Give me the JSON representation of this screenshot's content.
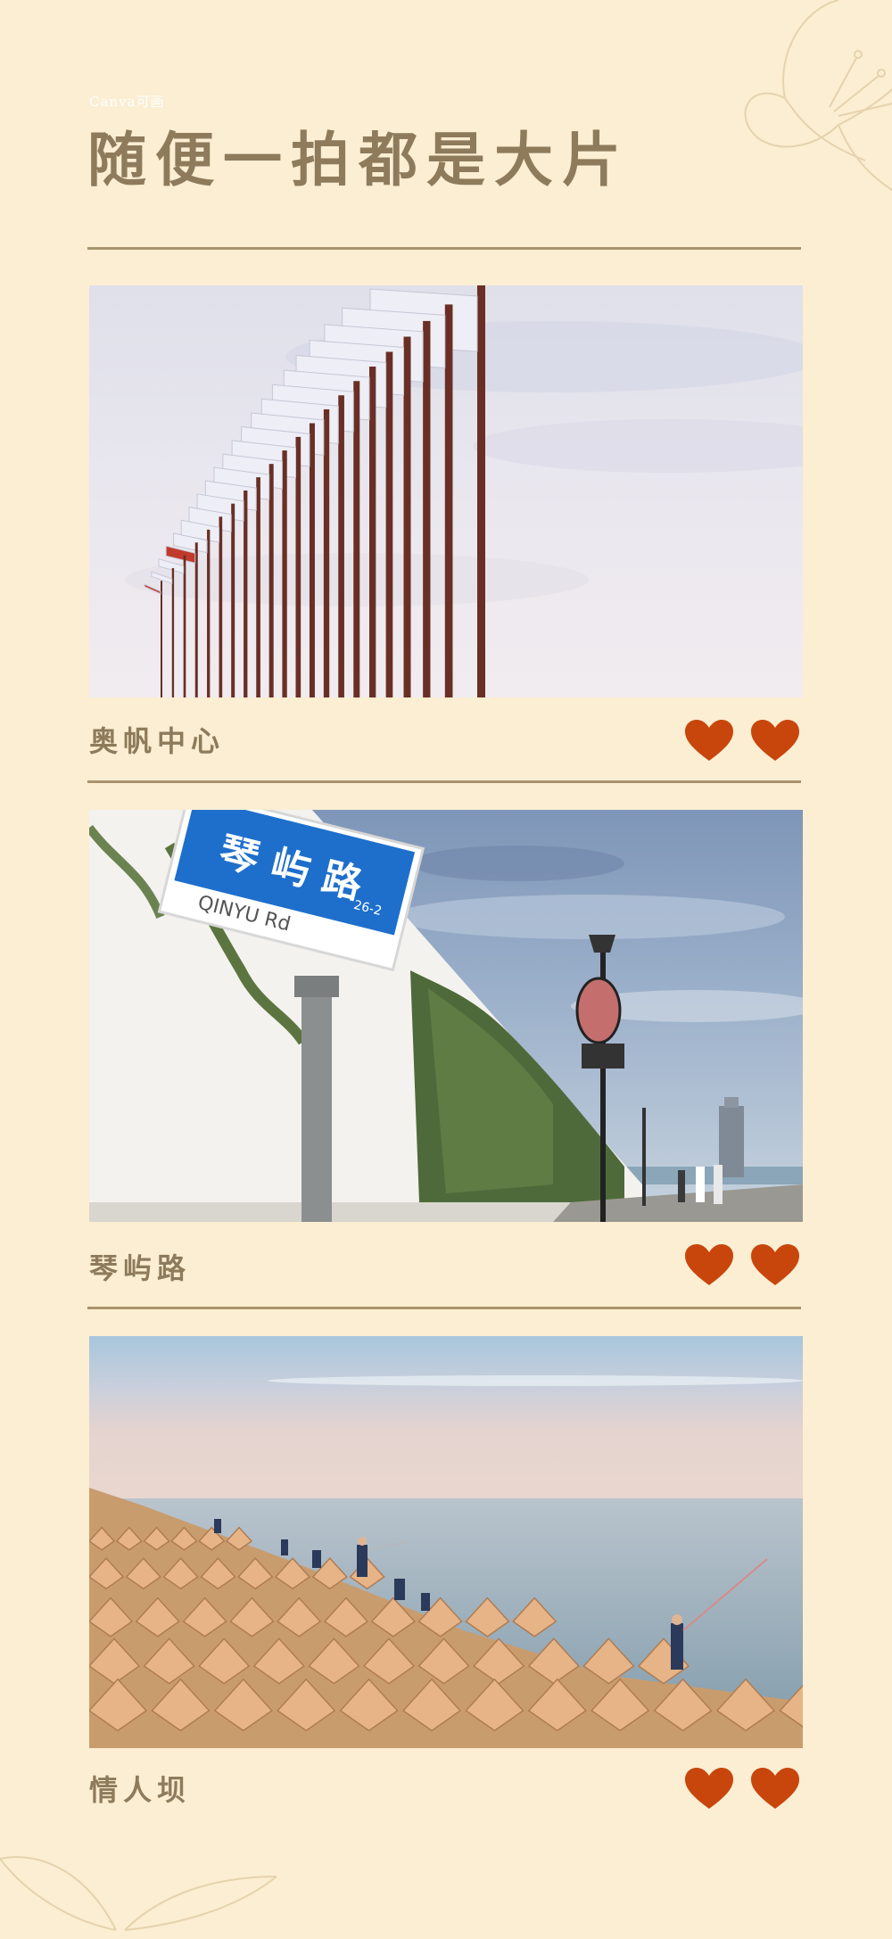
{
  "brand": "Canva可画",
  "title": "随便一拍都是大片",
  "colors": {
    "background": "#fbeed2",
    "title": "#8e7b5c",
    "heart": "#c8460c",
    "rule": "#a8946e"
  },
  "cards": [
    {
      "caption": "奥帆中心",
      "photo": "Olympic flags on poles under a cloudy sky",
      "hearts": [
        "heart-icon",
        "heart-icon"
      ]
    },
    {
      "caption": "琴屿路",
      "photo": "Blue road sign beside an ivy-covered white wall by the sea",
      "sign": {
        "name": "琴 屿 路",
        "pinyin": "QINYU Rd",
        "number": "26-2"
      },
      "hearts": [
        "heart-icon",
        "heart-icon"
      ]
    },
    {
      "caption": "情人坝",
      "photo": "Breakwater of concrete tetrapods with people fishing at sunset",
      "hearts": [
        "heart-icon",
        "heart-icon"
      ]
    }
  ]
}
